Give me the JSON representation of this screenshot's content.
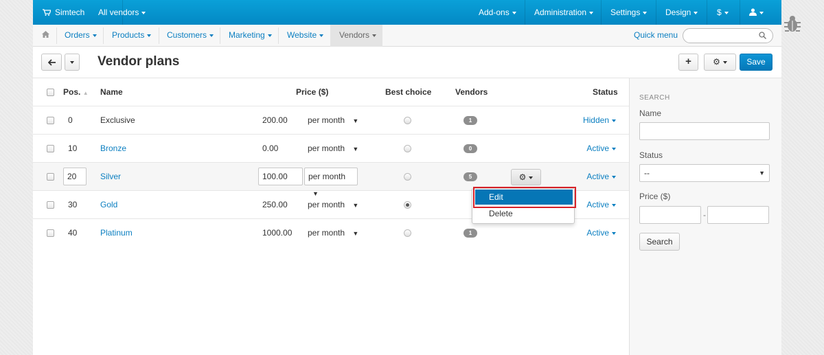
{
  "topbar": {
    "brand": "Simtech",
    "vendors": "All vendors",
    "menus": [
      "Add-ons",
      "Administration",
      "Settings",
      "Design",
      "$",
      ""
    ]
  },
  "subnav": {
    "tabs": [
      "Orders",
      "Products",
      "Customers",
      "Marketing",
      "Website",
      "Vendors"
    ],
    "active_tab": "Vendors",
    "quick_menu": "Quick menu"
  },
  "header": {
    "title": "Vendor plans",
    "save_label": "Save"
  },
  "table": {
    "columns": {
      "pos": "Pos.",
      "name": "Name",
      "price": "Price ($)",
      "best_choice": "Best choice",
      "vendors": "Vendors",
      "status": "Status"
    },
    "rows": [
      {
        "pos": "0",
        "name": "Exclusive",
        "price": "200.00",
        "period": "per month",
        "best": false,
        "vendors": "1",
        "status": "Hidden"
      },
      {
        "pos": "10",
        "name": "Bronze",
        "price": "0.00",
        "period": "per month",
        "best": false,
        "vendors": "0",
        "status": "Active"
      },
      {
        "pos": "20",
        "name": "Silver",
        "price": "100.00",
        "period": "per month",
        "best": false,
        "vendors": "5",
        "status": "Active"
      },
      {
        "pos": "30",
        "name": "Gold",
        "price": "250.00",
        "period": "per month",
        "best": true,
        "vendors": "",
        "status": "Active"
      },
      {
        "pos": "40",
        "name": "Platinum",
        "price": "1000.00",
        "period": "per month",
        "best": false,
        "vendors": "1",
        "status": "Active"
      }
    ]
  },
  "context_menu": {
    "items": [
      "Edit",
      "Delete"
    ],
    "selected": "Edit"
  },
  "sidebar": {
    "heading": "SEARCH",
    "name_label": "Name",
    "status_label": "Status",
    "status_value": "--",
    "price_label": "Price ($)",
    "range_sep": "-",
    "search_button": "Search"
  },
  "colors": {
    "accent": "#0b7fc1",
    "topbar": "#0388c4",
    "highlight": "#d8232a"
  }
}
